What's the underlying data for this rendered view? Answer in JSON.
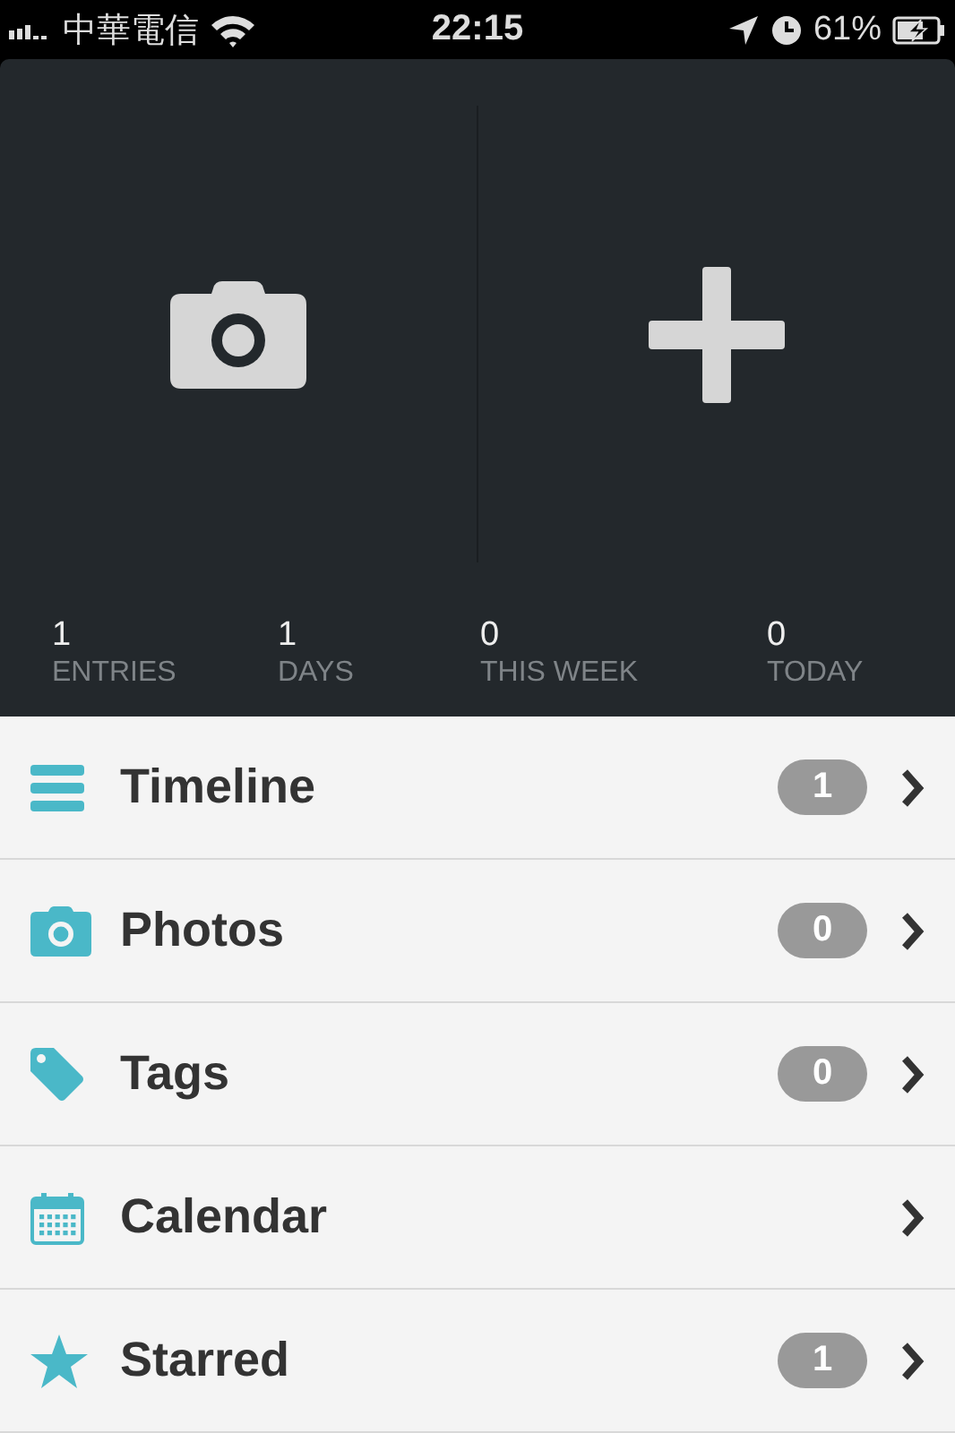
{
  "status_bar": {
    "carrier": "中華電信",
    "time": "22:15",
    "battery": "61%"
  },
  "actions": [
    {
      "kind": "camera"
    },
    {
      "kind": "plus"
    }
  ],
  "stats": [
    {
      "value": "1",
      "label": "ENTRIES"
    },
    {
      "value": "1",
      "label": "DAYS"
    },
    {
      "value": "0",
      "label": "THIS WEEK"
    },
    {
      "value": "0",
      "label": "TODAY"
    }
  ],
  "menu": [
    {
      "kind": "timeline",
      "label": "Timeline",
      "count": "1"
    },
    {
      "kind": "photos",
      "label": "Photos",
      "count": "0"
    },
    {
      "kind": "tags",
      "label": "Tags",
      "count": "0"
    },
    {
      "kind": "calendar",
      "label": "Calendar"
    },
    {
      "kind": "starred",
      "label": "Starred",
      "count": "1"
    }
  ]
}
